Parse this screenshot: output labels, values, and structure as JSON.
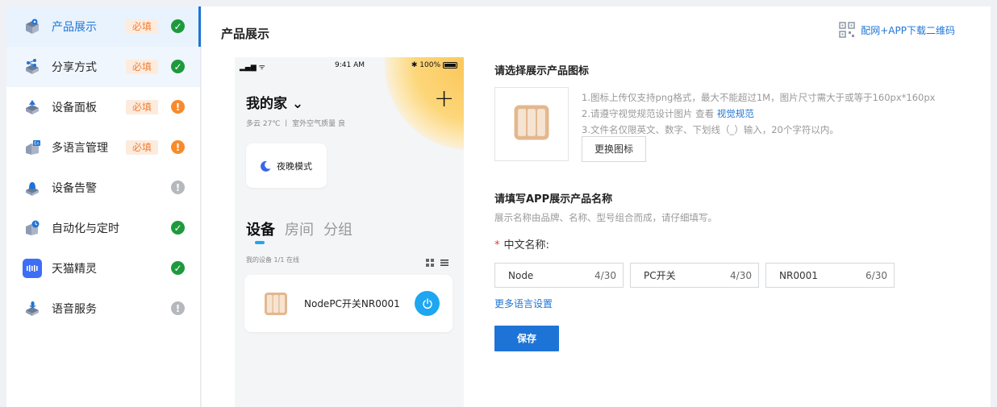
{
  "sidebar": {
    "items": [
      {
        "label": "产品展示",
        "required": "必填",
        "status": "ok",
        "icon": "product-display-icon"
      },
      {
        "label": "分享方式",
        "required": "必填",
        "status": "ok",
        "icon": "share-icon"
      },
      {
        "label": "设备面板",
        "required": "必填",
        "status": "warn",
        "icon": "device-panel-icon"
      },
      {
        "label": "多语言管理",
        "required": "必填",
        "status": "warn",
        "icon": "language-icon"
      },
      {
        "label": "设备告警",
        "required": "",
        "status": "na",
        "icon": "device-alarm-icon"
      },
      {
        "label": "自动化与定时",
        "required": "",
        "status": "ok",
        "icon": "automation-timer-icon"
      },
      {
        "label": "天猫精灵",
        "required": "",
        "status": "ok",
        "icon": "tmall-genie-icon"
      },
      {
        "label": "语音服务",
        "required": "",
        "status": "na",
        "icon": "voice-service-icon"
      }
    ]
  },
  "main": {
    "title": "产品展示",
    "qr_link": "配网+APP下载二维码"
  },
  "phone": {
    "signal": "▂▄▆ ᯤ",
    "time": "9:41 AM",
    "battery": "✱ 100%",
    "home_title": "我的家",
    "home_chevron": "⌄",
    "plus": "+",
    "weather": "多云 27℃  丨 室外空气质量 良",
    "scene_label": "夜晚模式",
    "tabs": [
      "设备",
      "房间",
      "分组"
    ],
    "device_meta": "我的设备   1/1 在线",
    "device_name": "NodePC开关NR0001"
  },
  "form": {
    "icon_section_title": "请选择展示产品图标",
    "tip1": "1.图标上传仅支持png格式，最大不能超过1M，图片尺寸需大于或等于160px*160px",
    "tip2_prefix": "2.请遵守视觉规范设计图片 查看 ",
    "tip2_link": "视觉规范",
    "tip3": "3.文件名仅限英文、数字、下划线（_）输入，20个字符以内。",
    "change_icon_button": "更换图标",
    "name_section_title": "请填写APP展示产品名称",
    "name_hint": "展示名称由品牌、名称、型号组合而成，请仔细填写。",
    "field_required_mark": "*",
    "field_label": "中文名称:",
    "inputs": [
      {
        "value": "Node",
        "count": "4/30"
      },
      {
        "value": "PC开关",
        "count": "4/30"
      },
      {
        "value": "NR0001",
        "count": "6/30"
      }
    ],
    "more_languages_link": "更多语言设置",
    "save_button": "保存"
  },
  "colors": {
    "accent": "#1e74d6",
    "ok": "#1e9a3d",
    "warn": "#f98a2c",
    "na": "#b5b8bd",
    "required_badge_bg": "#fdecde",
    "required_badge_text": "#f0803a"
  }
}
